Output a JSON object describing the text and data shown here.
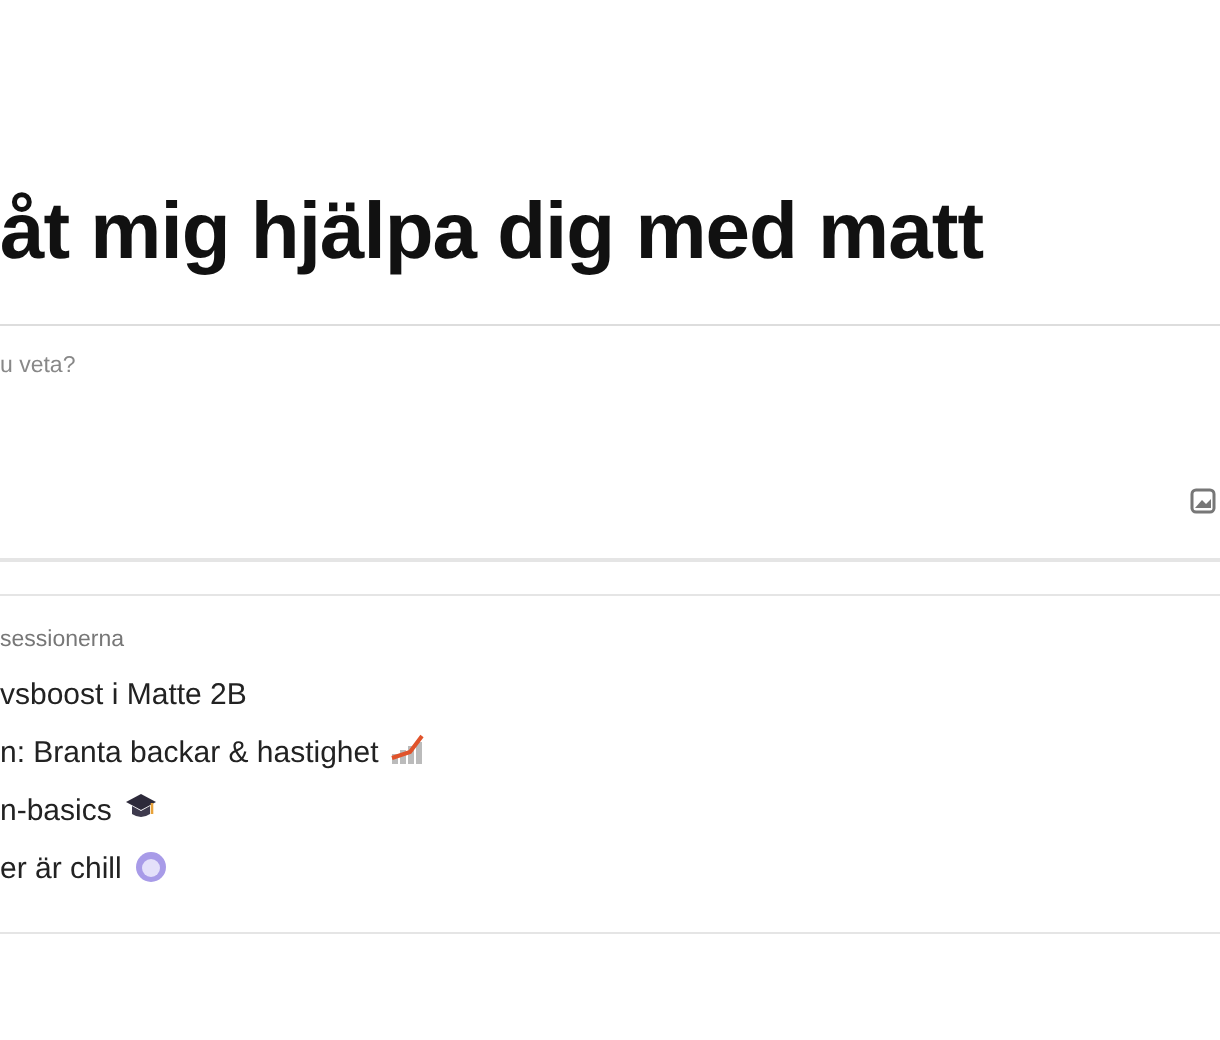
{
  "heading": "åt mig hjälpa dig med matt",
  "prompt": {
    "placeholder": "u veta?"
  },
  "sessions": {
    "title": "sessionerna",
    "items": [
      {
        "label": "vsboost i Matte 2B",
        "kind": "plain"
      },
      {
        "label": "n: Branta backar & hastighet",
        "kind": "chart"
      },
      {
        "label": "n-basics",
        "kind": "cap"
      },
      {
        "label": "er är chill",
        "kind": "round"
      }
    ]
  }
}
